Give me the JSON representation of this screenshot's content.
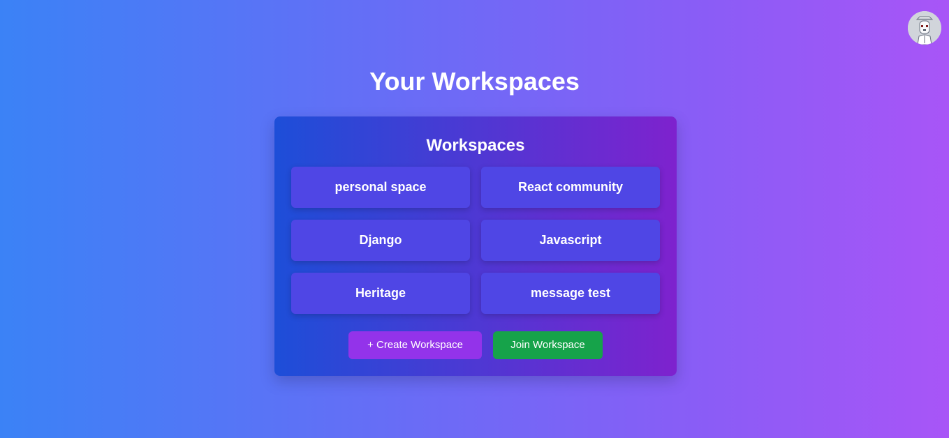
{
  "header": {
    "title": "Your Workspaces"
  },
  "panel": {
    "title": "Workspaces",
    "workspaces": [
      {
        "label": "personal space"
      },
      {
        "label": "React community"
      },
      {
        "label": "Django"
      },
      {
        "label": "Javascript"
      },
      {
        "label": "Heritage"
      },
      {
        "label": "message test"
      }
    ]
  },
  "actions": {
    "create_label": "+ Create Workspace",
    "join_label": "Join Workspace"
  },
  "icons": {
    "avatar": "user-avatar-icon"
  },
  "colors": {
    "background_start": "#3b82f6",
    "background_end": "#a855f7",
    "panel_start": "#1d4ed8",
    "panel_end": "#7e22ce",
    "tile": "#4f46e5",
    "create_button": "#9333ea",
    "join_button": "#16a34a"
  }
}
